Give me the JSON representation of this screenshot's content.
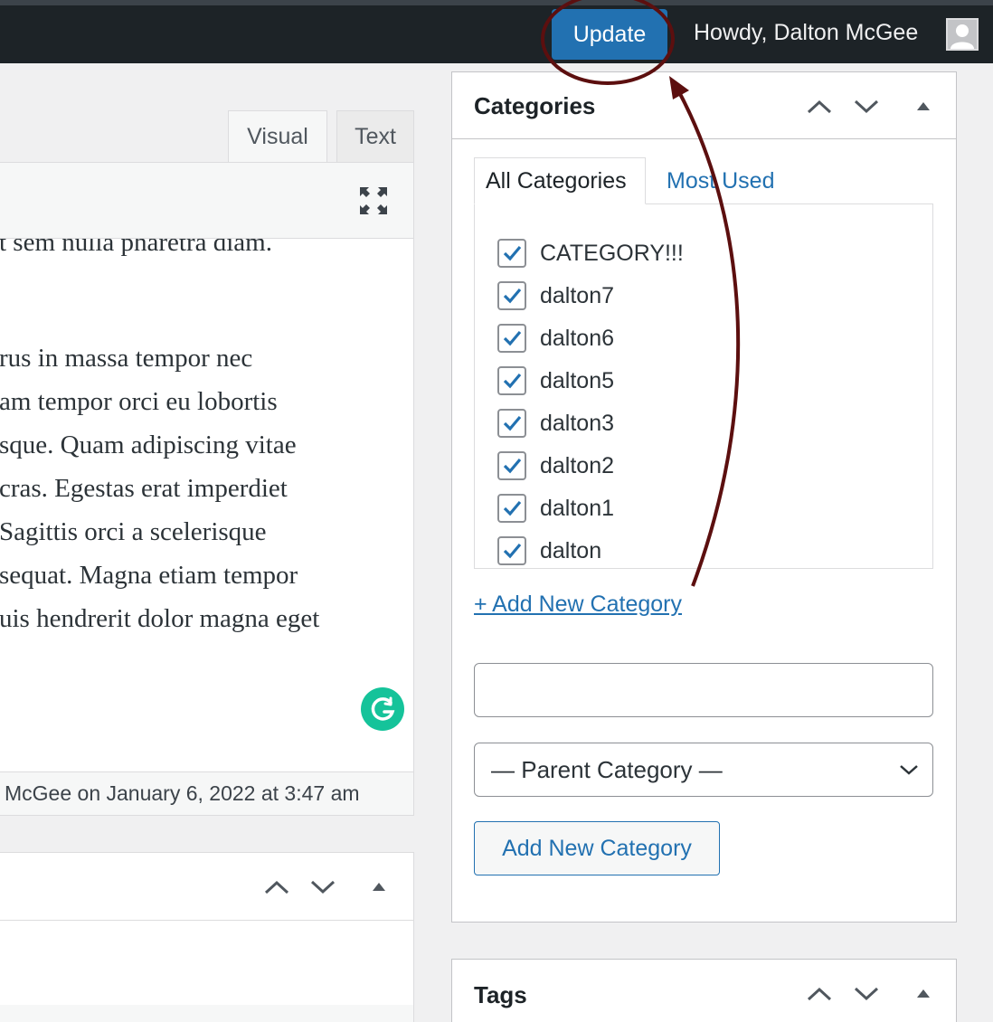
{
  "adminbar": {
    "update_label": "Update",
    "howdy_text": "Howdy, Dalton McGee"
  },
  "editor": {
    "tabs": [
      {
        "label": "Visual"
      },
      {
        "label": "Text"
      }
    ],
    "lines": [
      "t sem nulla pharetra diam.",
      "rus in massa tempor nec",
      "am tempor orci eu lobortis",
      "sque. Quam adipiscing vitae",
      " cras. Egestas erat imperdiet",
      "Sagittis orci a scelerisque",
      "sequat. Magna etiam tempor",
      "uis hendrerit dolor magna eget"
    ],
    "last_edited": "McGee on January 6, 2022 at 3:47 am"
  },
  "categories": {
    "title": "Categories",
    "tabs": [
      {
        "label": "All Categories"
      },
      {
        "label": "Most Used"
      }
    ],
    "items": [
      {
        "label": "CATEGORY!!!",
        "checked": true
      },
      {
        "label": "dalton7",
        "checked": true
      },
      {
        "label": "dalton6",
        "checked": true
      },
      {
        "label": "dalton5",
        "checked": true
      },
      {
        "label": "dalton3",
        "checked": true
      },
      {
        "label": "dalton2",
        "checked": true
      },
      {
        "label": "dalton1",
        "checked": true
      },
      {
        "label": "dalton",
        "checked": true
      }
    ],
    "add_new_link": "+ Add New Category",
    "new_category_value": "",
    "parent_select": "— Parent Category —",
    "add_button": "Add New Category"
  },
  "tags": {
    "title": "Tags"
  },
  "colors": {
    "adminbar": "#1d2327",
    "accent": "#2271b1",
    "annotation": "#5c0f0f",
    "grammarly": "#15c39a"
  }
}
